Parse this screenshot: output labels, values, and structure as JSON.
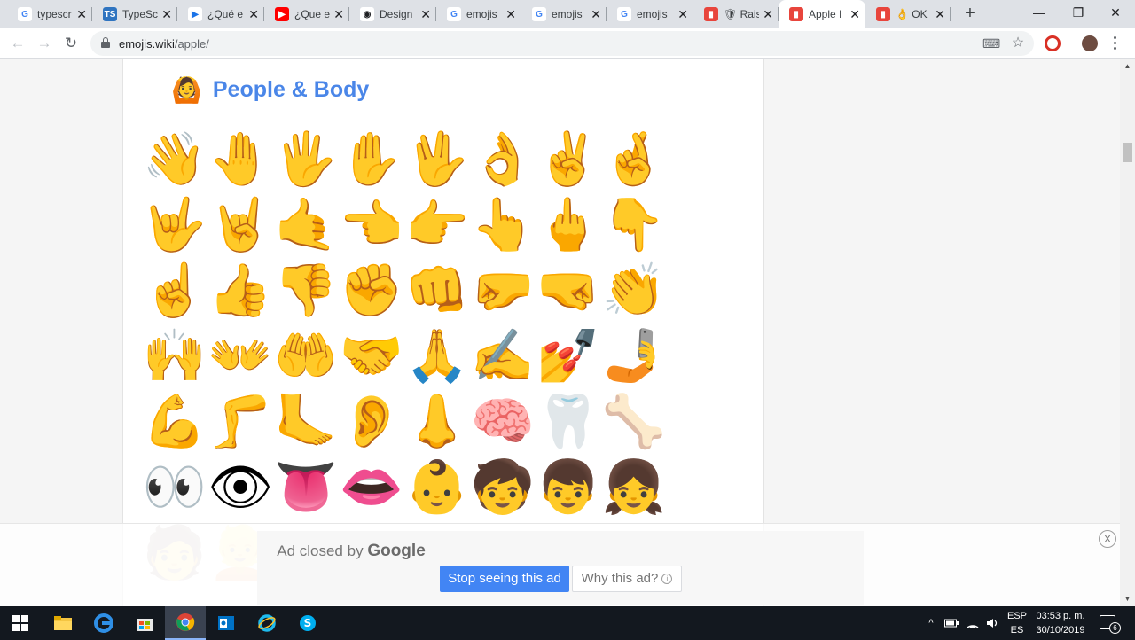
{
  "browser": {
    "tabs": [
      {
        "title": "typescr",
        "favicon": "G",
        "favicon_color": "#4285f4",
        "favicon_bg": "#ffffff",
        "active": false
      },
      {
        "title": "TypeSc",
        "favicon": "TS",
        "favicon_color": "#ffffff",
        "favicon_bg": "#2f74c0",
        "active": false
      },
      {
        "title": "¿Qué e",
        "favicon": "▶",
        "favicon_color": "#1a73e8",
        "favicon_bg": "#ffffff",
        "active": false
      },
      {
        "title": "¿Que e",
        "favicon": "▶",
        "favicon_color": "#ffffff",
        "favicon_bg": "#ff0000",
        "active": false
      },
      {
        "title": "Design",
        "favicon": "◉",
        "favicon_color": "#202124",
        "favicon_bg": "#ffffff",
        "active": false
      },
      {
        "title": "emojis",
        "favicon": "G",
        "favicon_color": "#4285f4",
        "favicon_bg": "#ffffff",
        "active": false
      },
      {
        "title": "emojis",
        "favicon": "G",
        "favicon_color": "#4285f4",
        "favicon_bg": "#ffffff",
        "active": false
      },
      {
        "title": "emojis",
        "favicon": "G",
        "favicon_color": "#4285f4",
        "favicon_bg": "#ffffff",
        "active": false
      },
      {
        "title": "🛡 Rais",
        "favicon": "▮",
        "favicon_color": "#ffffff",
        "favicon_bg": "#e8453c",
        "active": false
      },
      {
        "title": "Apple I",
        "favicon": "▮",
        "favicon_color": "#ffffff",
        "favicon_bg": "#e8453c",
        "active": true
      },
      {
        "title": "👌 OK I",
        "favicon": "▮",
        "favicon_color": "#ffffff",
        "favicon_bg": "#e8453c",
        "active": false
      }
    ],
    "tab_close_glyph": "✕",
    "new_tab_glyph": "+",
    "window_controls": {
      "minimize": "—",
      "maximize": "❐",
      "close": "✕"
    },
    "nav": {
      "back": "←",
      "forward": "→",
      "reload": "↻"
    },
    "url_host": "emojis.wiki",
    "url_path": "/apple/",
    "translate_glyph": "⌨",
    "bookmark_glyph": "☆",
    "extension_color": "#d93025",
    "avatar_color": "#6d4c41"
  },
  "page": {
    "section_emoji": "🙆",
    "section_title": "People & Body",
    "title_color": "#4a86e8",
    "rows": [
      [
        "👋",
        "🤚",
        "🖐",
        "✋",
        "🖖",
        "👌",
        "✌",
        "🤞"
      ],
      [
        "🤟",
        "🤘",
        "🤙",
        "👈",
        "👉",
        "👆",
        "🖕",
        "👇"
      ],
      [
        "☝",
        "👍",
        "👎",
        "✊",
        "👊",
        "🤛",
        "🤜",
        "👏"
      ],
      [
        "🙌",
        "👐",
        "🤲",
        "🤝",
        "🙏",
        "✍",
        "💅",
        "🤳"
      ],
      [
        "💪",
        "🦵",
        "🦶",
        "👂",
        "👃",
        "🧠",
        "🦷",
        "🦴"
      ],
      [
        "👀",
        "👁",
        "👅",
        "👄",
        "👶",
        "🧒",
        "👦",
        "👧"
      ]
    ],
    "faded_row": [
      "🧑",
      "👱"
    ],
    "faded_row2": [
      "👨",
      "👩"
    ]
  },
  "ad": {
    "closed_text": "Ad closed by",
    "brand": "Google",
    "stop_button": "Stop seeing this ad",
    "why_button": "Why this ad?",
    "info_glyph": "i",
    "close_glyph": "X",
    "stop_color": "#4285f4"
  },
  "taskbar": {
    "apps": [
      "windows-start",
      "file-explorer",
      "edge",
      "store",
      "chrome",
      "outlook",
      "internet-explorer",
      "skype"
    ],
    "active_app": "chrome",
    "tray": {
      "chevron": "^",
      "lang_top": "ESP",
      "lang_bottom": "ES",
      "time": "03:53 p. m.",
      "date": "30/10/2019",
      "notifications": "6"
    }
  }
}
